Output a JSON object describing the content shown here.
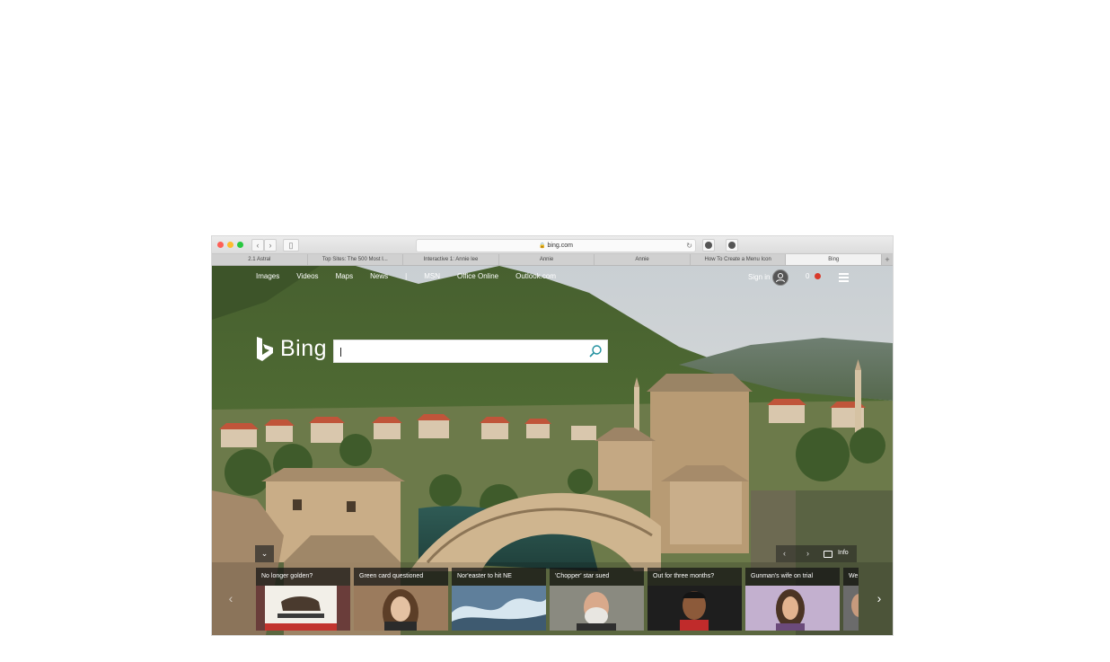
{
  "browser": {
    "address": "bing.com",
    "tabs": [
      {
        "label": "2.1 Astral"
      },
      {
        "label": "Top Sites: The 500 Most I..."
      },
      {
        "label": "Interactive 1: Annie lee"
      },
      {
        "label": "Annie"
      },
      {
        "label": "Annie"
      },
      {
        "label": "How To Create a Menu Icon"
      },
      {
        "label": "Bing"
      }
    ],
    "new_tab": "+"
  },
  "nav": {
    "items": [
      "Images",
      "Videos",
      "Maps",
      "News",
      "|",
      "MSN",
      "Office Online",
      "Outlook.com"
    ]
  },
  "header": {
    "signin": "Sign in",
    "rewards_count": "0"
  },
  "brand": {
    "name": "Bing"
  },
  "search": {
    "value": ""
  },
  "image_controls": {
    "info": "Info"
  },
  "news": [
    {
      "title": "No longer golden?",
      "image": "california-flag"
    },
    {
      "title": "Green card questioned",
      "image": "woman-portrait"
    },
    {
      "title": "Nor'easter to hit NE",
      "image": "crashing-waves"
    },
    {
      "title": "'Chopper' star sued",
      "image": "bearded-man"
    },
    {
      "title": "Out for three months?",
      "image": "athlete-portrait"
    },
    {
      "title": "Gunman's wife on trial",
      "image": "courtroom-sketch"
    },
    {
      "title": "We",
      "image": "partial"
    }
  ],
  "colors": {
    "accent": "#1f8f9e",
    "sky": "#d7dde2",
    "mountain": "#4f6b33",
    "stone": "#b99a74"
  }
}
